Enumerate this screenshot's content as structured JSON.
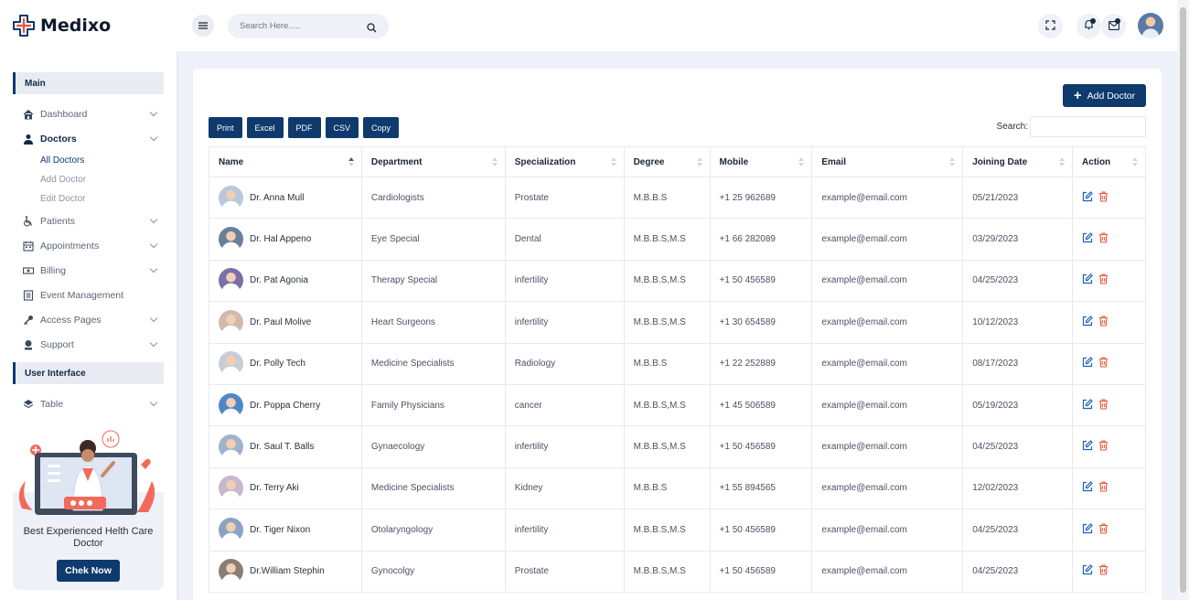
{
  "app": {
    "name": "Medixo"
  },
  "sidebar": {
    "section_main": "Main",
    "section_ui": "User Interface",
    "items": [
      {
        "label": "Dashboard",
        "icon": "home-icon"
      },
      {
        "label": "Doctors",
        "icon": "doctor-icon"
      },
      {
        "label": "Patients",
        "icon": "wheelchair-icon"
      },
      {
        "label": "Appointments",
        "icon": "calendar-icon"
      },
      {
        "label": "Billing",
        "icon": "money-icon"
      },
      {
        "label": "Event Management",
        "icon": "document-icon"
      },
      {
        "label": "Access Pages",
        "icon": "key-icon"
      },
      {
        "label": "Support",
        "icon": "support-icon"
      },
      {
        "label": "Table",
        "icon": "layers-icon"
      }
    ],
    "doctors_sub": [
      "All Doctors",
      "Add Doctor",
      "Edit Doctor"
    ],
    "promo_text": "Best Experienced Helth Care Doctor",
    "promo_button": "Chek Now"
  },
  "header": {
    "search_placeholder": "Search Here....."
  },
  "toolbar": {
    "add_doctor": "Add Doctor",
    "exports": [
      "Print",
      "Excel",
      "PDF",
      "CSV",
      "Copy"
    ],
    "search_label": "Search:"
  },
  "table": {
    "columns": [
      "Name",
      "Department",
      "Specialization",
      "Degree",
      "Mobile",
      "Email",
      "Joining Date",
      "Action"
    ],
    "rows": [
      [
        "Dr. Anna Mull",
        "Cardiologists",
        "Prostate",
        "M.B.B.S",
        "+1 25 962689",
        "example@email.com",
        "05/21/2023"
      ],
      [
        "Dr. Hal Appeno",
        "Eye Special",
        "Dental",
        "M.B.B.S,M.S",
        "+1 66 282089",
        "example@email.com",
        "03/29/2023"
      ],
      [
        "Dr. Pat Agonia",
        "Therapy Special",
        "infertility",
        "M.B.B.S,M.S",
        "+1 50 456589",
        "example@email.com",
        "04/25/2023"
      ],
      [
        "Dr. Paul Molive",
        "Heart Surgeons",
        "infertility",
        "M.B.B.S,M.S",
        "+1 30 654589",
        "example@email.com",
        "10/12/2023"
      ],
      [
        "Dr. Polly Tech",
        "Medicine Specialists",
        "Radiology",
        "M.B.B.S",
        "+1 22 252889",
        "example@email.com",
        "08/17/2023"
      ],
      [
        "Dr. Poppa Cherry",
        "Family Physicians",
        "cancer",
        "M.B.B.S,M.S",
        "+1 45 506589",
        "example@email.com",
        "05/19/2023"
      ],
      [
        "Dr. Saul T. Balls",
        "Gynaecology",
        "infertility",
        "M.B.B.S,M.S",
        "+1 50 456589",
        "example@email.com",
        "04/25/2023"
      ],
      [
        "Dr. Terry Aki",
        "Medicine Specialists",
        "Kidney",
        "M.B.B.S",
        "+1 55 894565",
        "example@email.com",
        "12/02/2023"
      ],
      [
        "Dr. Tiger Nixon",
        "Otolaryngology",
        "infertility",
        "M.B.B.S,M.S",
        "+1 50 456589",
        "example@email.com",
        "04/25/2023"
      ],
      [
        "Dr.William Stephin",
        "Gynocolgy",
        "Prostate",
        "M.B.B.S,M.S",
        "+1 50 456589",
        "example@email.com",
        "04/25/2023"
      ]
    ]
  },
  "colors": {
    "primary": "#0f3a6e",
    "edit": "#1f5fbf",
    "delete": "#e8553a"
  }
}
